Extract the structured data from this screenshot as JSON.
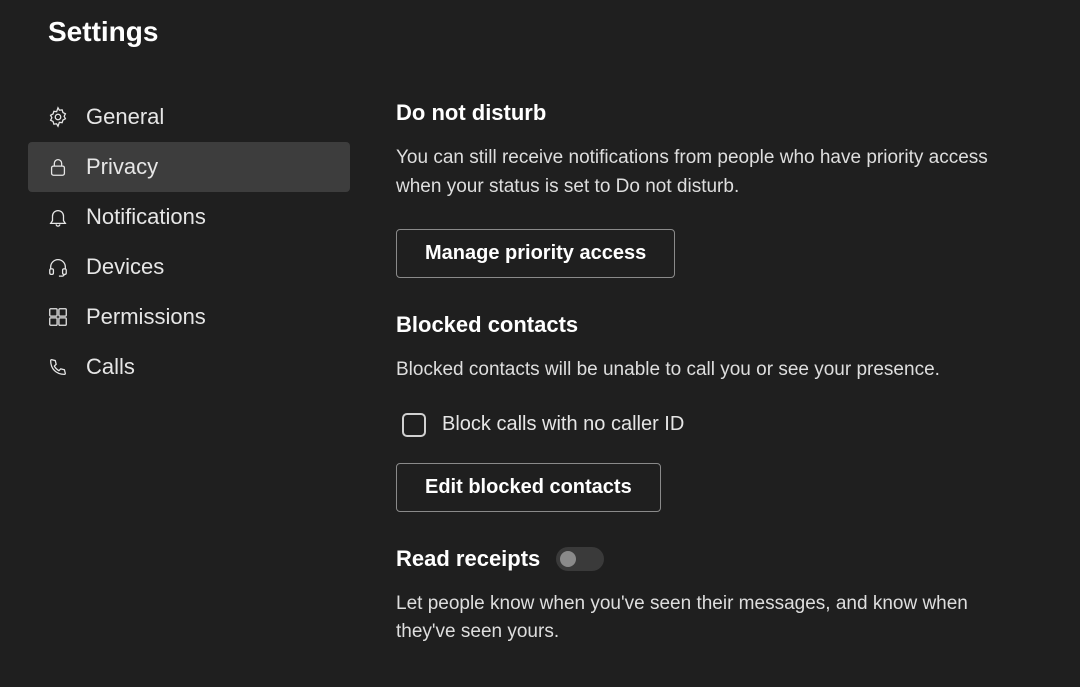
{
  "page_title": "Settings",
  "sidebar": {
    "items": [
      {
        "label": "General"
      },
      {
        "label": "Privacy"
      },
      {
        "label": "Notifications"
      },
      {
        "label": "Devices"
      },
      {
        "label": "Permissions"
      },
      {
        "label": "Calls"
      }
    ]
  },
  "sections": {
    "dnd": {
      "heading": "Do not disturb",
      "desc": "You can still receive notifications from people who have priority access when your status is set to Do not disturb.",
      "button": "Manage priority access"
    },
    "blocked": {
      "heading": "Blocked contacts",
      "desc": "Blocked contacts will be unable to call you or see your presence.",
      "checkbox_label": "Block calls with no caller ID",
      "button": "Edit blocked contacts"
    },
    "read_receipts": {
      "heading": "Read receipts",
      "desc": "Let people know when you've seen their messages, and know when they've seen yours."
    }
  }
}
